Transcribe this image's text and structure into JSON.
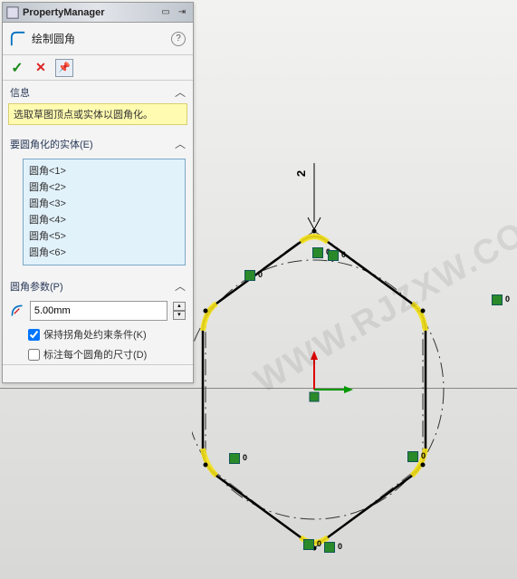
{
  "titlebar": {
    "title": "PropertyManager"
  },
  "command": {
    "name": "绘制圆角"
  },
  "sections": {
    "info": {
      "label": "信息",
      "text": "选取草图顶点或实体以圆角化。"
    },
    "entities": {
      "label": "要圆角化的实体(E)",
      "items": [
        "圆角<1>",
        "圆角<2>",
        "圆角<3>",
        "圆角<4>",
        "圆角<5>",
        "圆角<6>"
      ]
    },
    "params": {
      "label": "圆角参数(P)",
      "radius": "5.00mm",
      "keep_corner_label": "保持拐角处约束条件(K)",
      "keep_corner_checked": true,
      "dim_each_label": "标注每个圆角的尺寸(D)",
      "dim_each_checked": false
    }
  },
  "sketch": {
    "dimension": "2",
    "relation_label": "0"
  },
  "watermark": "WWW.RJZXW.COM"
}
